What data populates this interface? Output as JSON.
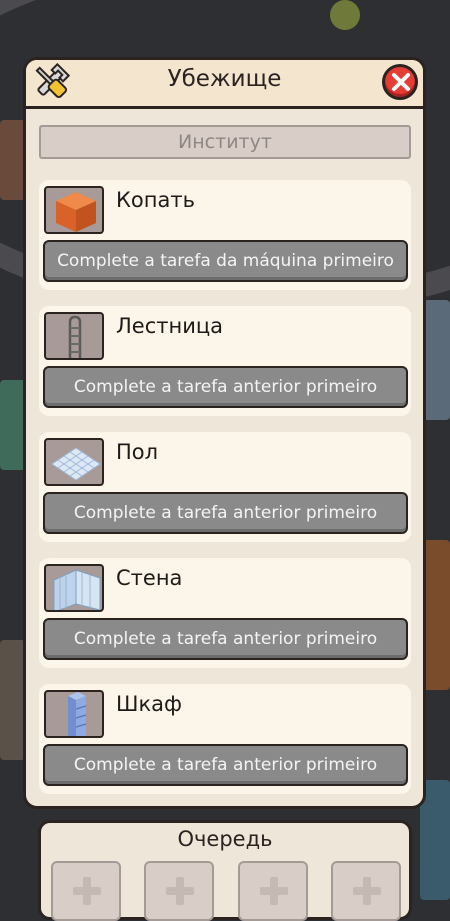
{
  "dialog": {
    "title": "Убежище",
    "tools_icon": "wrench-screwdriver-icon",
    "close_icon": "close-icon"
  },
  "tab": {
    "label": "Институт"
  },
  "items": [
    {
      "name": "Копать",
      "icon": "dirt-block-icon",
      "action": "Complete a tarefa da máquina primeiro"
    },
    {
      "name": "Лестница",
      "icon": "ladder-icon",
      "action": "Complete a tarefa anterior primeiro"
    },
    {
      "name": "Пол",
      "icon": "floor-tile-icon",
      "action": "Complete a tarefa anterior primeiro"
    },
    {
      "name": "Стена",
      "icon": "wall-icon",
      "action": "Complete a tarefa anterior primeiro"
    },
    {
      "name": "Шкаф",
      "icon": "cabinet-icon",
      "action": "Complete a tarefa anterior primeiro"
    }
  ],
  "queue": {
    "title": "Очередь",
    "slot_icon": "plus-icon"
  },
  "colors": {
    "panel_bg": "#efe6da",
    "card_bg": "#fcf5ea",
    "button_disabled": "#8a8a8a",
    "close_red": "#e53d36",
    "outline": "#2a2320"
  }
}
